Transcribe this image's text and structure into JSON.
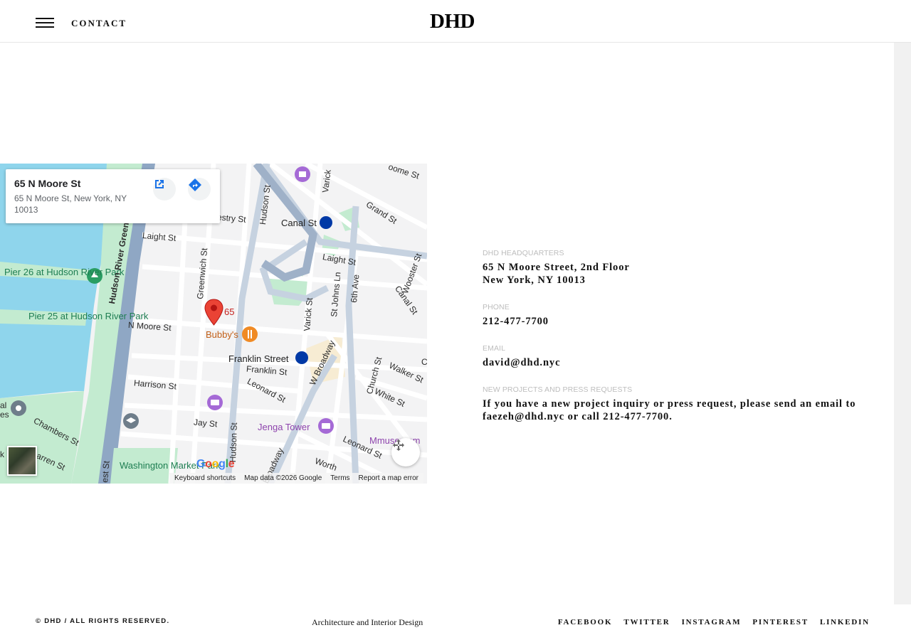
{
  "header": {
    "nav_contact": "CONTACT",
    "logo": "DHD"
  },
  "map": {
    "info_card": {
      "title": "65 N Moore St",
      "address": "65 N Moore St, New York, NY 10013"
    },
    "labels": {
      "pier26": "Pier 26 at Hudson River Park",
      "pier25": "Pier 25 at Hudson River Park",
      "hudson_river_greenway": "Hudson River Greenway",
      "laight_st_left": "Laight St",
      "laight_st_right": "Laight St",
      "greenwich_st": "Greenwich St",
      "hudson_st_top": "Hudson St",
      "hudson_st_bottom": "Hudson St",
      "canal_st": "Canal St",
      "grand_st": "Grand St",
      "varick_st_top": "Varick",
      "varick_st": "Varick St",
      "st_johns_ln": "St Johns Ln",
      "sixth_ave": "6th Ave",
      "canal_st_right": "Canal St",
      "wooster_st": "Wooster St",
      "n_moore_st": "N Moore St",
      "pin_label": "65",
      "bubbys": "Bubby's",
      "franklin_street": "Franklin Street",
      "franklin_st": "Franklin St",
      "w_broadway": "W Broadway",
      "church_st": "Church St",
      "walker_st": "Walker St",
      "white_st": "White St",
      "harrison_st": "Harrison St",
      "leonard_st": "Leonard St",
      "leonard_st_right": "Leonard St",
      "jay_st": "Jay St",
      "jenga_tower": "Jenga Tower",
      "chambers_st": "Chambers St",
      "warren_st": "arren St",
      "washington_market_park": "Washington Market Park",
      "broadway": "Broadway",
      "worth": "Worth",
      "mmuseumm": "Mmuseumm",
      "west_st": "est St",
      "destry_st": "estry St",
      "moore_top": "oome St",
      "hud_left": "al",
      "hud_left2": "es",
      "k_left": "k",
      "c_right": "C"
    },
    "attribution": {
      "keyboard": "Keyboard shortcuts",
      "mapdata": "Map data ©2026 Google",
      "terms": "Terms",
      "report": "Report a map error"
    },
    "google": [
      "G",
      "o",
      "o",
      "g",
      "l",
      "e"
    ]
  },
  "contact": {
    "hq_label": "DHD HEADQUARTERS",
    "hq_line1": "65 N Moore Street, 2nd Floor",
    "hq_line2": "New York, NY 10013",
    "phone_label": "PHONE",
    "phone": "212-477-7700",
    "email_label": "EMAIL",
    "email": "david@dhd.nyc",
    "press_label": "NEW PROJECTS AND PRESS REQUESTS",
    "press_text": "If you have a new project inquiry or press request, please send an email to faezeh@dhd.nyc or call 212-477-7700."
  },
  "footer": {
    "copyright": "© DHD / ALL RIGHTS RESERVED.",
    "tagline": "Architecture and Interior Design",
    "social": {
      "facebook": "FACEBOOK",
      "twitter": "TWITTER",
      "instagram": "INSTAGRAM",
      "pinterest": "PINTEREST",
      "linkedin": "LINKEDIN"
    }
  },
  "colors": {
    "water": "#8fd5ec",
    "park": "#c3ebd0",
    "road": "#ffffff",
    "highway": "#8fa7c4",
    "pin": "#ea4335"
  }
}
